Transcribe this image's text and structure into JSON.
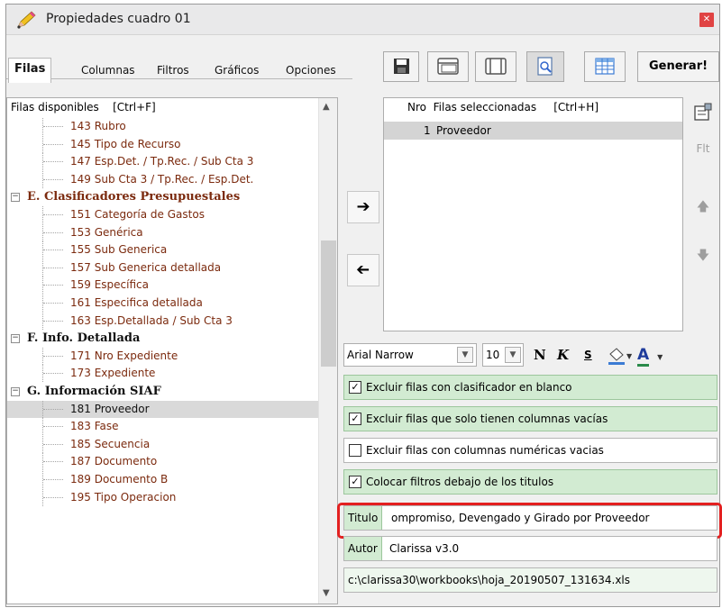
{
  "window": {
    "title": "Propiedades cuadro 01"
  },
  "tabs": [
    "Filas",
    "Columnas",
    "Filtros",
    "Gráficos",
    "Opciones"
  ],
  "toolbar": {
    "generate_label": "Generar!"
  },
  "left_list": {
    "header": "Filas disponibles    [Ctrl+F]",
    "rows": [
      {
        "text": "143 Rubro",
        "kind": "item"
      },
      {
        "text": "145 Tipo de Recurso",
        "kind": "item"
      },
      {
        "text": "147 Esp.Det. / Tp.Rec. / Sub Cta 3",
        "kind": "item"
      },
      {
        "text": "149 Sub Cta 3 / Tp.Rec. / Esp.Det.",
        "kind": "item"
      },
      {
        "text": "E. Clasificadores Presupuestales",
        "kind": "group-brown"
      },
      {
        "text": "151 Categoría de Gastos",
        "kind": "item"
      },
      {
        "text": "153 Genérica",
        "kind": "item"
      },
      {
        "text": "155 Sub Generica",
        "kind": "item"
      },
      {
        "text": "157 Sub Generica detallada",
        "kind": "item"
      },
      {
        "text": "159 Específica",
        "kind": "item"
      },
      {
        "text": "161 Especifica detallada",
        "kind": "item"
      },
      {
        "text": "163 Esp.Detallada / Sub Cta 3",
        "kind": "item"
      },
      {
        "text": "F. Info. Detallada",
        "kind": "group"
      },
      {
        "text": "171 Nro Expediente",
        "kind": "item"
      },
      {
        "text": "173 Expediente",
        "kind": "item"
      },
      {
        "text": "G. Información SIAF",
        "kind": "group"
      },
      {
        "text": "181 Proveedor",
        "kind": "selected"
      },
      {
        "text": "183 Fase",
        "kind": "item"
      },
      {
        "text": "185 Secuencia",
        "kind": "item"
      },
      {
        "text": "187 Documento",
        "kind": "item"
      },
      {
        "text": "189 Documento B",
        "kind": "item"
      },
      {
        "text": "195 Tipo Operacion",
        "kind": "item"
      }
    ]
  },
  "selected_list": {
    "header": "Nro  Filas seleccionadas     [Ctrl+H]",
    "rows": [
      {
        "nro": "1",
        "name": "Proveedor"
      }
    ]
  },
  "side_buttons": {
    "filter_label": "Flt"
  },
  "font": {
    "family": "Arial Narrow",
    "size": "10"
  },
  "format_buttons": {
    "bold": "N",
    "italic": "K",
    "strike": "S",
    "color_letter": "A"
  },
  "options": [
    {
      "label": "Excluir filas con clasificador en blanco",
      "checked": true
    },
    {
      "label": "Excluir filas que solo tienen columnas vacías",
      "checked": true
    },
    {
      "label": "Excluir filas con columnas numéricas vacias",
      "checked": false
    },
    {
      "label": "Colocar filtros debajo de los titulos",
      "checked": true
    }
  ],
  "fields": {
    "titulo_label": "Titulo",
    "titulo_value": "ompromiso, Devengado y Girado por Proveedor",
    "autor_label": "Autor",
    "autor_value": "Clarissa v3.0",
    "path_value": "c:\\clarissa30\\workbooks\\hoja_20190507_131634.xls"
  },
  "colors": {
    "accent_green": "#d2ebd2",
    "tree_text": "#7b2a0e",
    "highlight_red": "#e32020"
  }
}
